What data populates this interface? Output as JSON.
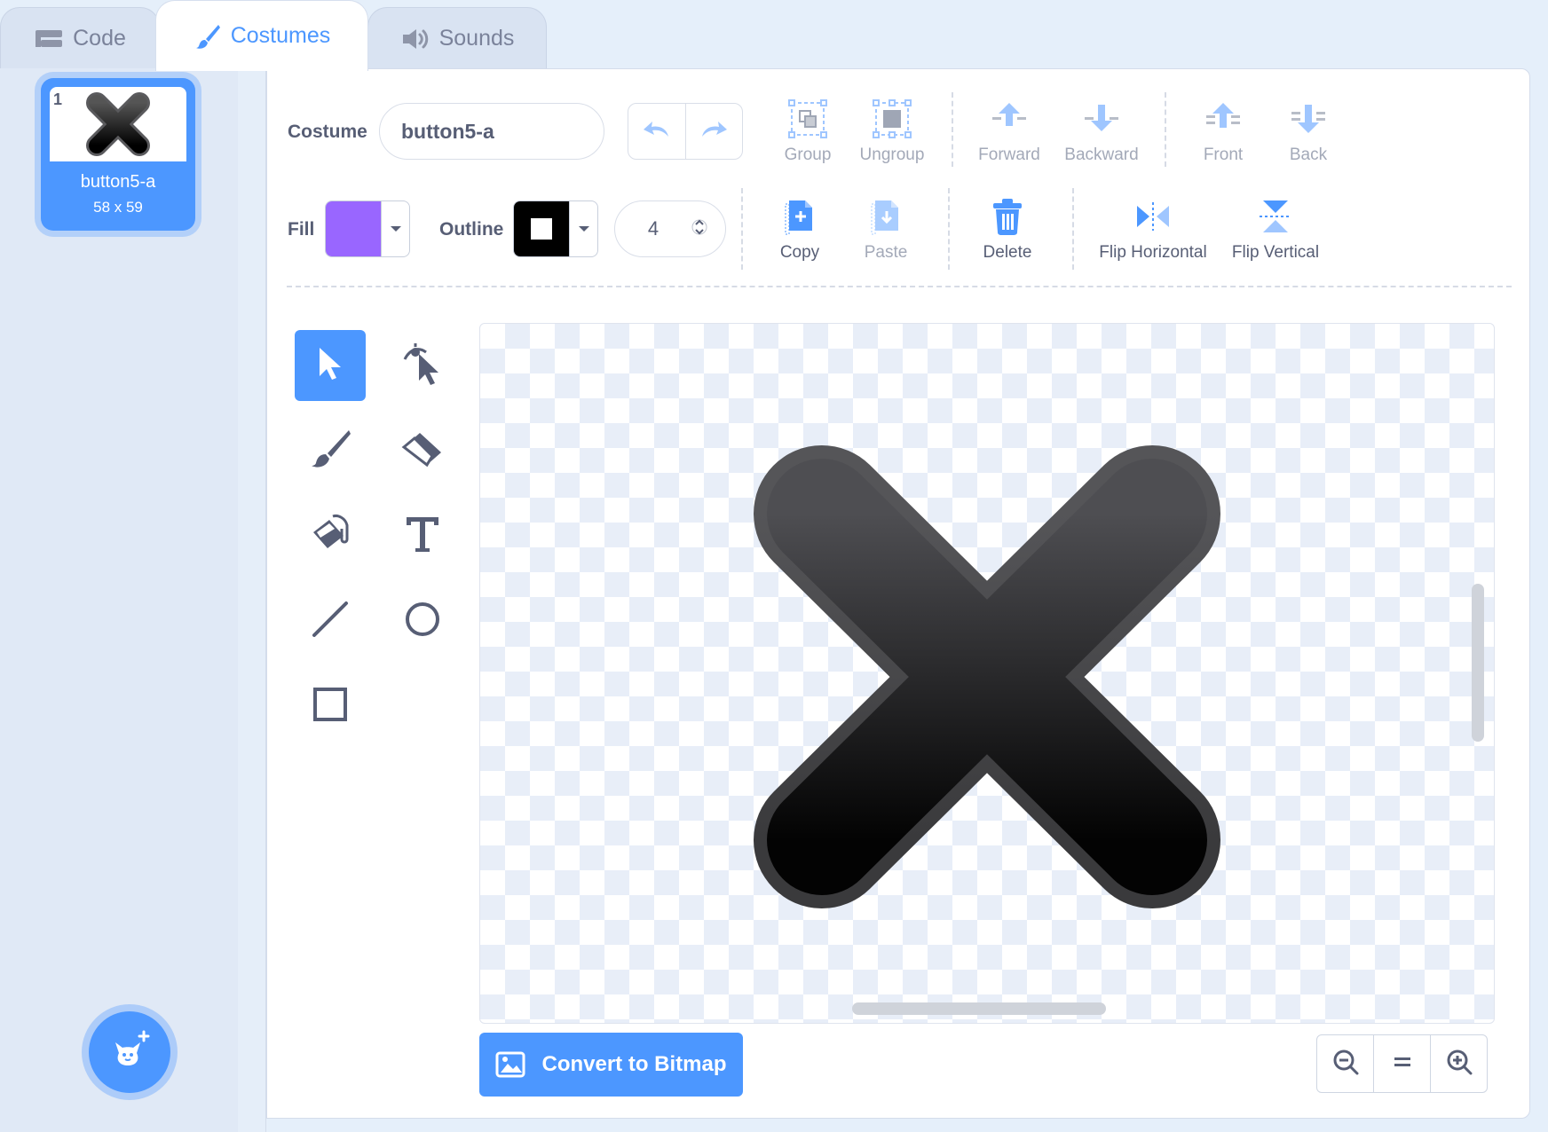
{
  "tabs": {
    "code": "Code",
    "costumes": "Costumes",
    "sounds": "Sounds"
  },
  "costume_list": [
    {
      "number": "1",
      "name": "button5-a",
      "size": "58 x 59"
    }
  ],
  "editor": {
    "costume_label": "Costume",
    "costume_name": "button5-a",
    "fill_label": "Fill",
    "fill_color": "#9966ff",
    "outline_label": "Outline",
    "outline_color": "#000000",
    "outline_width": "4",
    "toolbar_top": {
      "group": "Group",
      "ungroup": "Ungroup",
      "forward": "Forward",
      "backward": "Backward",
      "front": "Front",
      "back": "Back"
    },
    "toolbar_bottom": {
      "copy": "Copy",
      "paste": "Paste",
      "delete": "Delete",
      "flip_horizontal": "Flip Horizontal",
      "flip_vertical": "Flip Vertical"
    },
    "tools": [
      "select-tool",
      "reshape-tool",
      "brush-tool",
      "eraser-tool",
      "fill-tool",
      "text-tool",
      "line-tool",
      "circle-tool",
      "rectangle-tool"
    ],
    "selected_tool": "select-tool",
    "convert_button": "Convert to Bitmap"
  },
  "colors": {
    "accent": "#4c97ff",
    "text": "#575e75",
    "disabled": "#a3a9b8"
  }
}
